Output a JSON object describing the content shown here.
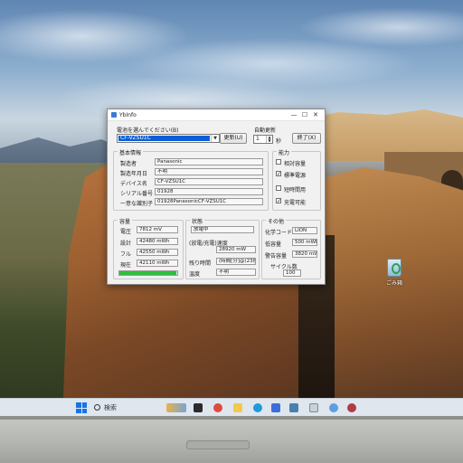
{
  "window": {
    "title": "YbInfo",
    "controls": {
      "minimize": "—",
      "maximize": "☐",
      "close": "✕"
    },
    "battery_select_label": "電池を選んでください(B)",
    "battery_selected": "CF-VZSU1C",
    "update_button": "更新(U)",
    "auto_update_label": "自動更新",
    "auto_update_value": "1",
    "auto_update_unit": "秒",
    "exit_button": "終了(X)"
  },
  "basic_info": {
    "title": "基本情報",
    "rows": [
      {
        "label": "製造者",
        "value": "Panasonic"
      },
      {
        "label": "製造年月日",
        "value": "不明"
      },
      {
        "label": "デバイス名",
        "value": "CF-VZSU1C"
      },
      {
        "label": "シリアル番号",
        "value": "01928"
      },
      {
        "label": "一意な識別子",
        "value": "01928PanasonicCF-VZSU1C"
      }
    ]
  },
  "capability": {
    "title": "能力",
    "items": [
      {
        "label": "相対容量",
        "checked": false,
        "mark": ""
      },
      {
        "label": "標準電源",
        "checked": true,
        "mark": "✓"
      },
      {
        "label": "短時間用",
        "checked": false,
        "mark": ""
      },
      {
        "label": "充電可能",
        "checked": true,
        "mark": "✓"
      }
    ]
  },
  "capacity": {
    "title": "容量",
    "rows": [
      {
        "label": "電圧",
        "value": "7812 mV"
      },
      {
        "label": "設計",
        "value": "42480 mWh"
      },
      {
        "label": "フル",
        "value": "42550 mWh"
      },
      {
        "label": "現在",
        "value": "42110 mWh"
      }
    ],
    "charge_percent": 99
  },
  "status": {
    "title": "状態",
    "state": "放電中",
    "rows": [
      {
        "label": "(放電/充電)速度",
        "value": "28920 mW"
      },
      {
        "label": "残り時間",
        "value": "(時間[分]@(23秒)"
      },
      {
        "label": "温度",
        "value": "不明"
      }
    ]
  },
  "other": {
    "title": "その他",
    "rows": [
      {
        "label": "化学コード",
        "value": "LION"
      },
      {
        "label": "低容量",
        "value": "500 mWh"
      },
      {
        "label": "警告容量",
        "value": "3820 mWh"
      },
      {
        "label": "サイクル数",
        "value": "100"
      }
    ]
  },
  "desktop": {
    "recycle_bin_label": "ごみ箱"
  },
  "taskbar": {
    "search_label": "検索",
    "app_icons": [
      "widgets-icon",
      "task-view-icon",
      "chrome-icon",
      "file-explorer-icon",
      "edge-icon",
      "store-icon",
      "photos-icon",
      "ybinfo-icon",
      "cloud-icon",
      "settings-icon"
    ]
  },
  "colors": {
    "selection": "#0a5fd7",
    "progress": "#2fbf3f",
    "start_accent": "#1a73e8"
  }
}
